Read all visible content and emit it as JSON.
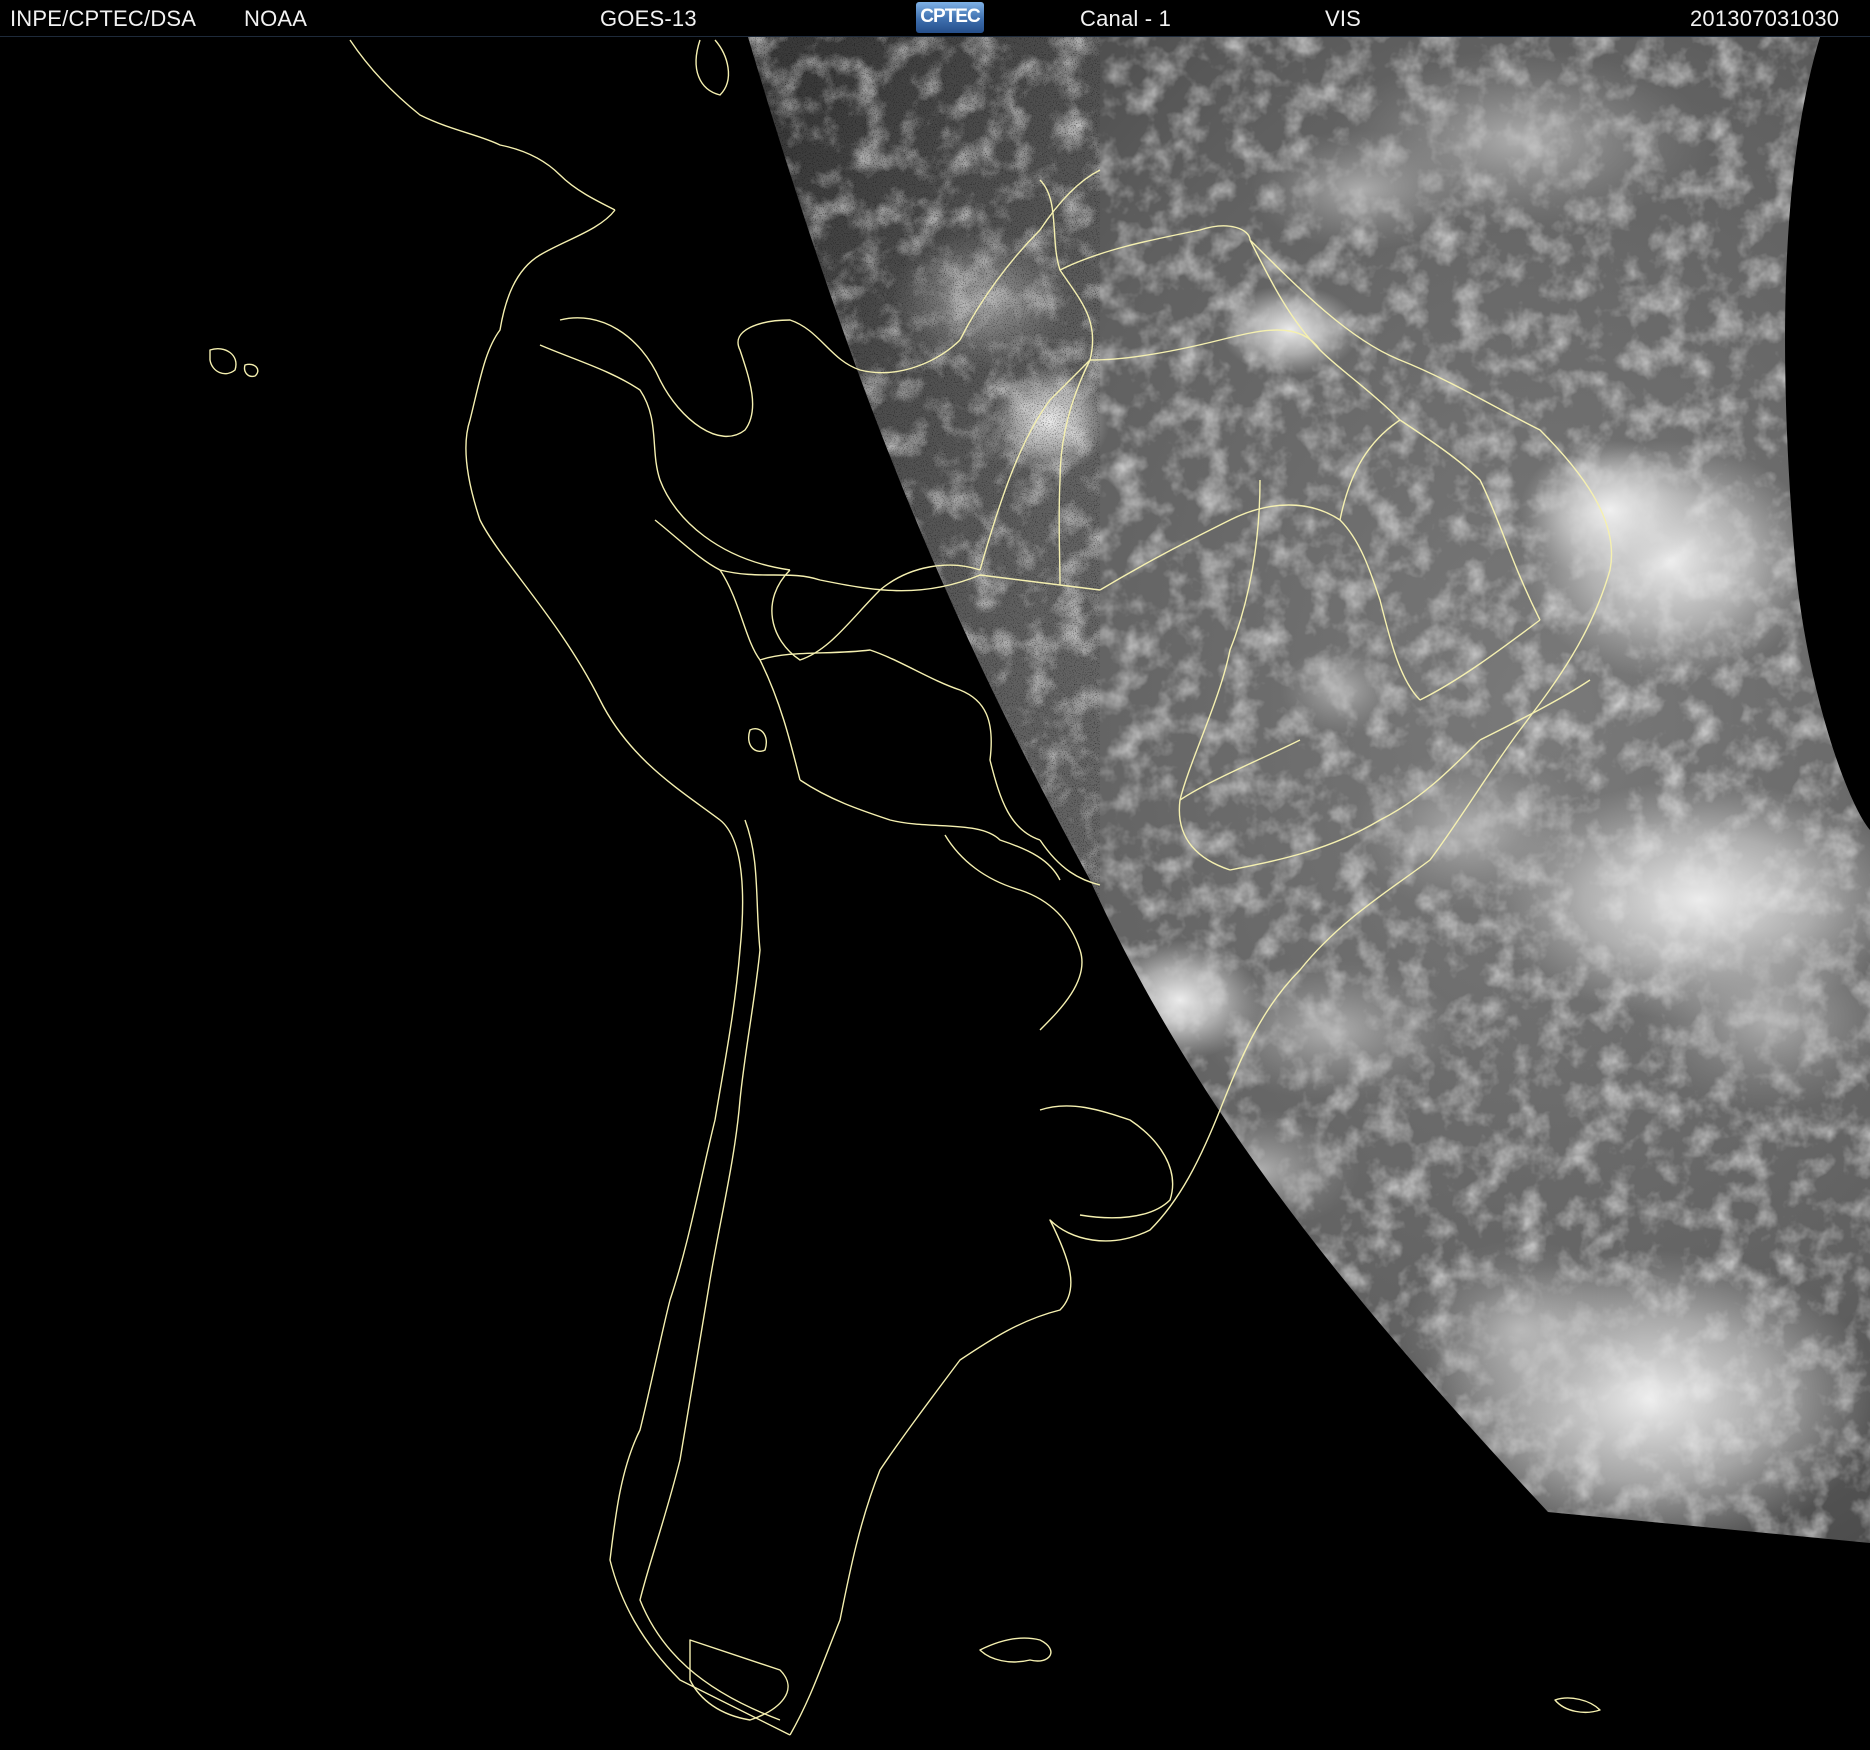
{
  "header": {
    "institution": "INPE/CPTEC/DSA",
    "agency": "NOAA",
    "satellite": "GOES-13",
    "logo_text": "CPTEC",
    "channel": "Canal - 1",
    "band": "VIS",
    "timestamp": "201307031030"
  },
  "colors": {
    "background": "#000000",
    "border_lines": "#f5f0b0",
    "header_text": "#f2f2f2",
    "cloud": "#ececec",
    "disk": "#6e6e6e"
  },
  "icons": {
    "logo": "cptec-logo"
  }
}
